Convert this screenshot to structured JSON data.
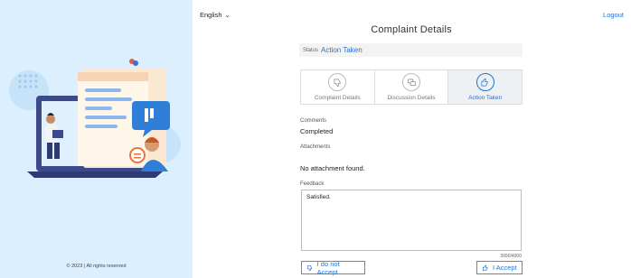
{
  "left_panel": {
    "copyright": "© 2023 | All rights reserved"
  },
  "header": {
    "language": "English",
    "logout_label": "Logout"
  },
  "page": {
    "title": "Complaint Details",
    "status_label": "Status",
    "status_value": "Action Taken"
  },
  "tabs": [
    {
      "label": "Complaint Details",
      "icon": "thumb-down-icon",
      "active": false
    },
    {
      "label": "Discussion Details",
      "icon": "chat-icon",
      "active": false
    },
    {
      "label": "Action Taken",
      "icon": "thumb-up-icon",
      "active": true
    }
  ],
  "details": {
    "comments_label": "Comments",
    "comments_value": "Completed",
    "attachments_label": "Attachments",
    "attachments_value": "No attachment found.",
    "feedback_label": "Feedback",
    "feedback_value": "Satisfied.",
    "char_counter": "3990/4000"
  },
  "actions": {
    "decline_label": "I do not Accept",
    "accept_label": "I Accept"
  },
  "colors": {
    "accent": "#1e73d6",
    "panel_bg": "#dcefff",
    "button_border": "#2fa6a6"
  }
}
